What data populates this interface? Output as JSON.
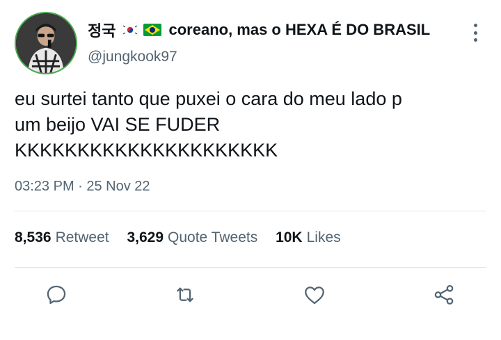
{
  "author": {
    "name_korean": "정국",
    "name_rest": "coreano, mas o HEXA É DO BRASIL",
    "handle": "@jungkook97",
    "flags": [
      "south-korea-flag",
      "brazil-flag"
    ]
  },
  "tweet": {
    "lines": [
      "eu surtei tanto que puxei o cara do meu lado p",
      "um beijo VAI SE FUDER",
      "KKKKKKKKKKKKKKKKKKKKK"
    ],
    "timestamp": "03:23 PM · 25 Nov 22"
  },
  "stats": {
    "retweets_count": "8,536",
    "retweets_label": "Retweet",
    "quotes_count": "3,629",
    "quotes_label": "Quote Tweets",
    "likes_count": "10K",
    "likes_label": "Likes"
  },
  "actions": [
    "reply-icon",
    "retweet-icon",
    "like-icon",
    "share-icon"
  ],
  "colors": {
    "text": "#0f1419",
    "secondary": "#536471",
    "divider": "#dfe3e6",
    "avatar_ring": "#4caf50"
  }
}
